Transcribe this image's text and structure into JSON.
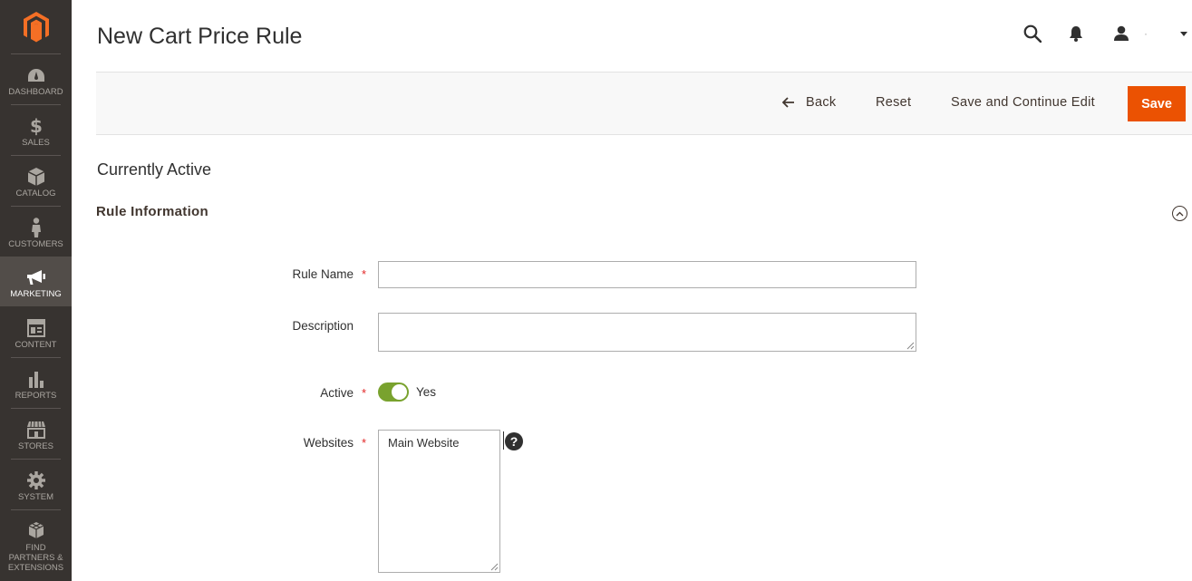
{
  "header": {
    "title": "New Cart Price Rule",
    "user_name": "·"
  },
  "sidebar": {
    "items": [
      {
        "label": "DASHBOARD",
        "icon": "dashboard-icon"
      },
      {
        "label": "SALES",
        "icon": "dollar-icon"
      },
      {
        "label": "CATALOG",
        "icon": "box-icon"
      },
      {
        "label": "CUSTOMERS",
        "icon": "person-icon"
      },
      {
        "label": "MARKETING",
        "icon": "megaphone-icon",
        "active": true
      },
      {
        "label": "CONTENT",
        "icon": "layout-icon"
      },
      {
        "label": "REPORTS",
        "icon": "bar-chart-icon"
      },
      {
        "label": "STORES",
        "icon": "store-icon"
      },
      {
        "label": "SYSTEM",
        "icon": "gear-icon"
      },
      {
        "label": "FIND PARTNERS & EXTENSIONS",
        "icon": "cubes-icon"
      }
    ]
  },
  "toolbar": {
    "back_label": "Back",
    "reset_label": "Reset",
    "save_continue_label": "Save and Continue Edit",
    "save_label": "Save"
  },
  "status": "Currently Active",
  "section": {
    "title": "Rule Information"
  },
  "form": {
    "rule_name": {
      "label": "Rule Name",
      "value": "",
      "required": true
    },
    "description": {
      "label": "Description",
      "value": ""
    },
    "active": {
      "label": "Active",
      "value_text": "Yes",
      "on": true,
      "required": true
    },
    "websites": {
      "label": "Websites",
      "options": [
        "Main Website"
      ],
      "required": true
    }
  },
  "colors": {
    "sidebar_bg": "#373330",
    "sidebar_active": "#524d49",
    "accent": "#eb5202",
    "toggle_on": "#79a22e",
    "required": "#e22626"
  }
}
